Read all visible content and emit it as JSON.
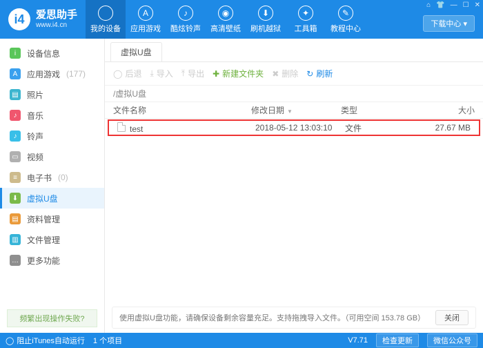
{
  "brand": {
    "name": "爱思助手",
    "url": "www.i4.cn"
  },
  "download_center_label": "下载中心",
  "window_controls": {
    "settings": "⌂",
    "shirt": "👕",
    "min": "—",
    "max": "☐",
    "close": "✕"
  },
  "top_nav": [
    {
      "label": "我的设备",
      "glyph": ""
    },
    {
      "label": "应用游戏",
      "glyph": "A"
    },
    {
      "label": "酷炫铃声",
      "glyph": "♪"
    },
    {
      "label": "高清壁纸",
      "glyph": "◉"
    },
    {
      "label": "刷机越狱",
      "glyph": "⬇"
    },
    {
      "label": "工具箱",
      "glyph": "✦"
    },
    {
      "label": "教程中心",
      "glyph": "✎"
    }
  ],
  "sidebar": [
    {
      "label": "设备信息",
      "count": "",
      "color": "#5ac65a",
      "glyph": "i"
    },
    {
      "label": "应用游戏",
      "count": "(177)",
      "color": "#3aa0ee",
      "glyph": "A"
    },
    {
      "label": "照片",
      "count": "",
      "color": "#3cb5cf",
      "glyph": "▤"
    },
    {
      "label": "音乐",
      "count": "",
      "color": "#f0566e",
      "glyph": "♪"
    },
    {
      "label": "铃声",
      "count": "",
      "color": "#39bfe8",
      "glyph": "♪"
    },
    {
      "label": "视频",
      "count": "",
      "color": "#b0b0b0",
      "glyph": "▭"
    },
    {
      "label": "电子书",
      "count": "(0)",
      "color": "#cdbb8c",
      "glyph": "≡"
    },
    {
      "label": "虚拟U盘",
      "count": "",
      "color": "#7aba4a",
      "glyph": "⬇"
    },
    {
      "label": "资料管理",
      "count": "",
      "color": "#ea9a3a",
      "glyph": "▤"
    },
    {
      "label": "文件管理",
      "count": "",
      "color": "#36b4d8",
      "glyph": "▥"
    },
    {
      "label": "更多功能",
      "count": "",
      "color": "#8f8f8f",
      "glyph": "…"
    }
  ],
  "sidebar_help": "频繁出现操作失败?",
  "tab_label": "虚拟U盘",
  "toolbar": {
    "back": "后退",
    "import": "导入",
    "export": "导出",
    "new_folder": "新建文件夹",
    "delete": "删除",
    "refresh": "刷新"
  },
  "breadcrumb": "/虚拟U盘",
  "columns": {
    "name": "文件名称",
    "date": "修改日期",
    "type": "类型",
    "size": "大小"
  },
  "rows": [
    {
      "name": "test",
      "date": "2018-05-12 13:03:10",
      "type": "文件",
      "size": "27.67 MB"
    }
  ],
  "hint": {
    "text": "使用虚拟U盘功能，请确保设备剩余容量充足。支持拖拽导入文件。（可用空间 153.78 GB）",
    "close": "关闭"
  },
  "status": {
    "itunes": "阻止iTunes自动运行",
    "items": "1 个项目",
    "version": "V7.71",
    "update": "检查更新",
    "wechat": "微信公众号"
  }
}
